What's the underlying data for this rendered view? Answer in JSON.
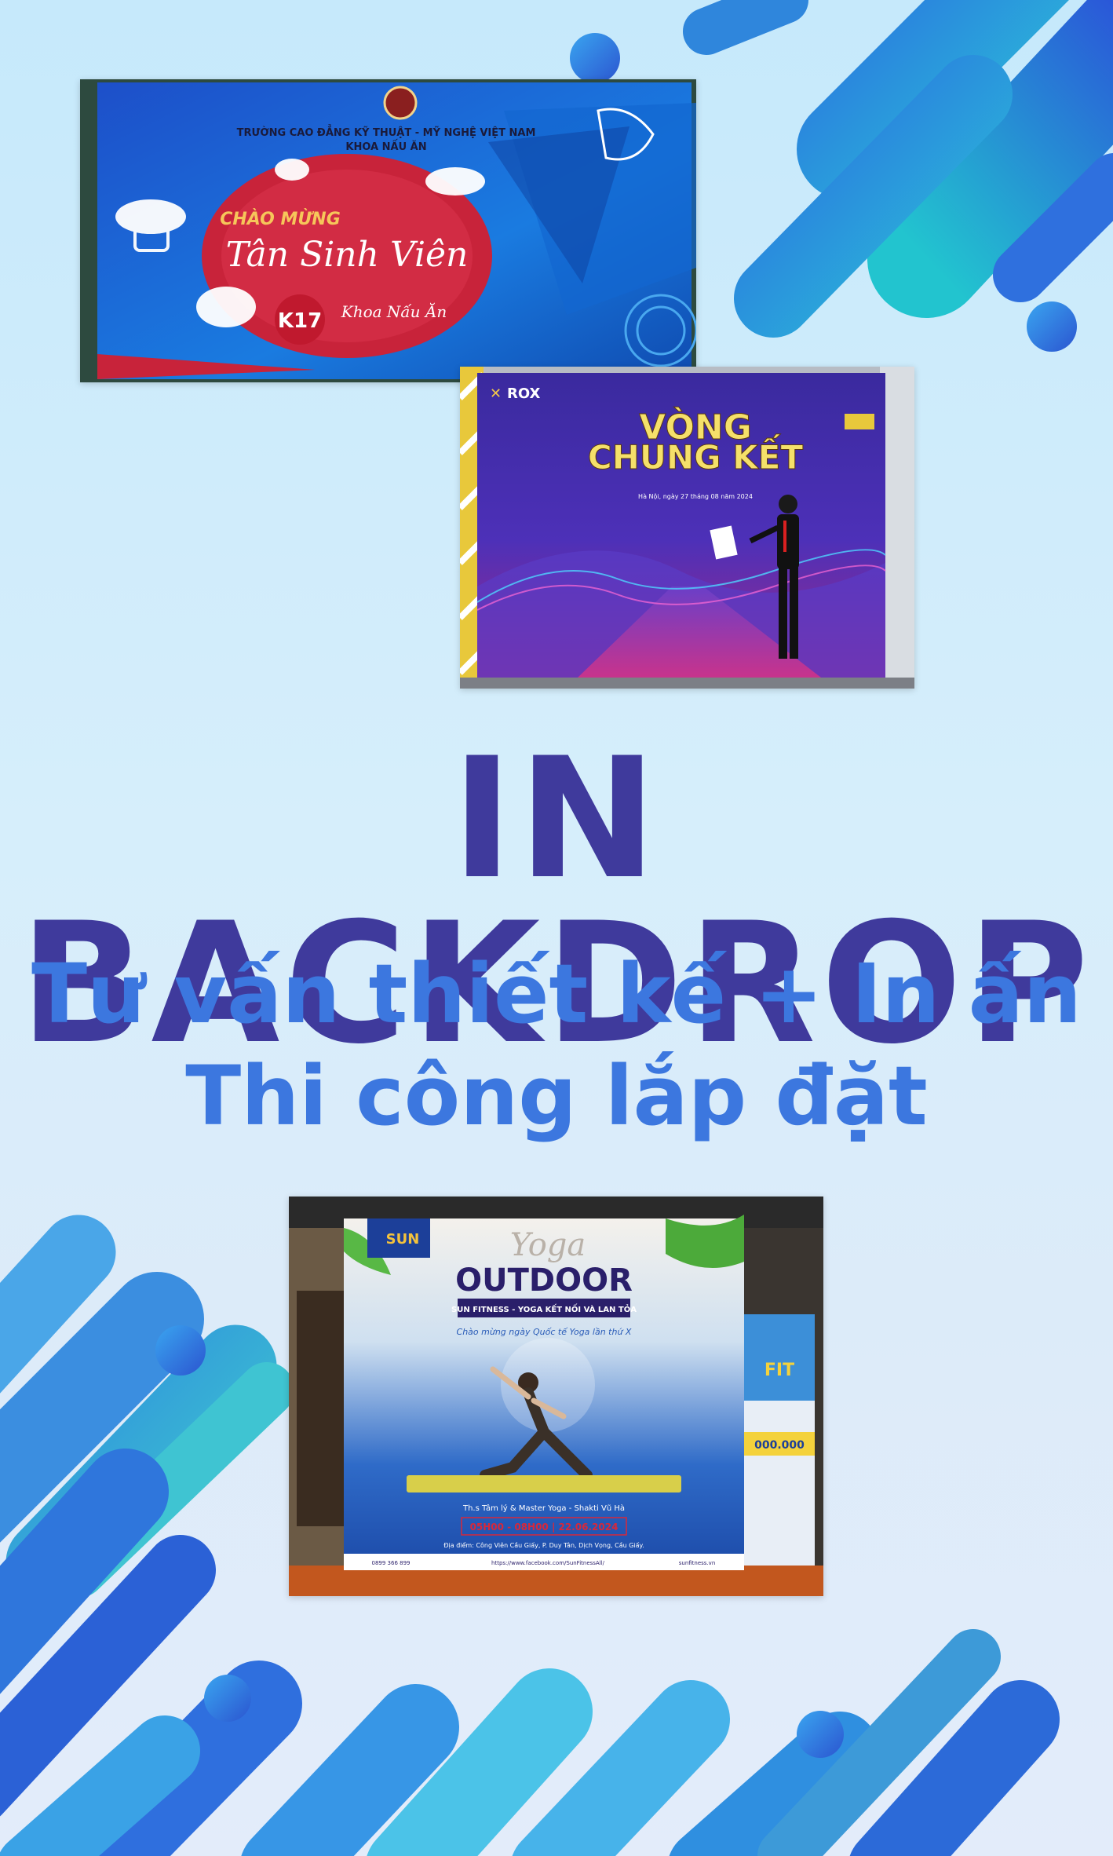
{
  "headline": {
    "title": "IN BACKDROP",
    "line1": "Tư vấn thiết kế + In ấn",
    "line2": "Thi công lắp đặt"
  },
  "photos": {
    "one": {
      "school": "TRƯỜNG CAO ĐẲNG KỸ THUẬT - MỸ NGHỆ VIỆT NAM",
      "faculty": "KHOA NẤU ĂN",
      "greeting": "CHÀO MỪNG",
      "main": "Tân Sinh Viên",
      "badge": "K17",
      "sub": "Khoa Nấu Ăn"
    },
    "two": {
      "brand": "ROX",
      "line1": "VÒNG",
      "line2": "CHUNG KẾT",
      "date": "Hà Nội, ngày 27 tháng 08 năm 2024"
    },
    "three": {
      "brand": "SUN",
      "script": "Yoga",
      "title": "OUTDOOR",
      "banner": "SUN FITNESS - YOGA KẾT NỐI VÀ LAN TỎA",
      "tagline": "Chào mừng ngày Quốc tế Yoga lần thứ X",
      "master": "Th.s Tâm lý & Master Yoga - Shakti Vũ Hà",
      "time": "05H00 - 08H00 | 22.06.2024",
      "venue": "Địa điểm: Công Viên Cầu Giấy, P. Duy Tân, Dịch Vọng, Cầu Giấy.",
      "phone": "0899 366 899",
      "facebook": "https://www.facebook.com/SunFitnessAll/",
      "website": "sunfitness.vn",
      "side_fit": "FIT",
      "side_price": "000.000"
    }
  },
  "colors": {
    "title": "#3f3a9c",
    "subtitle": "#3c77df",
    "background": "#cfeafb"
  }
}
